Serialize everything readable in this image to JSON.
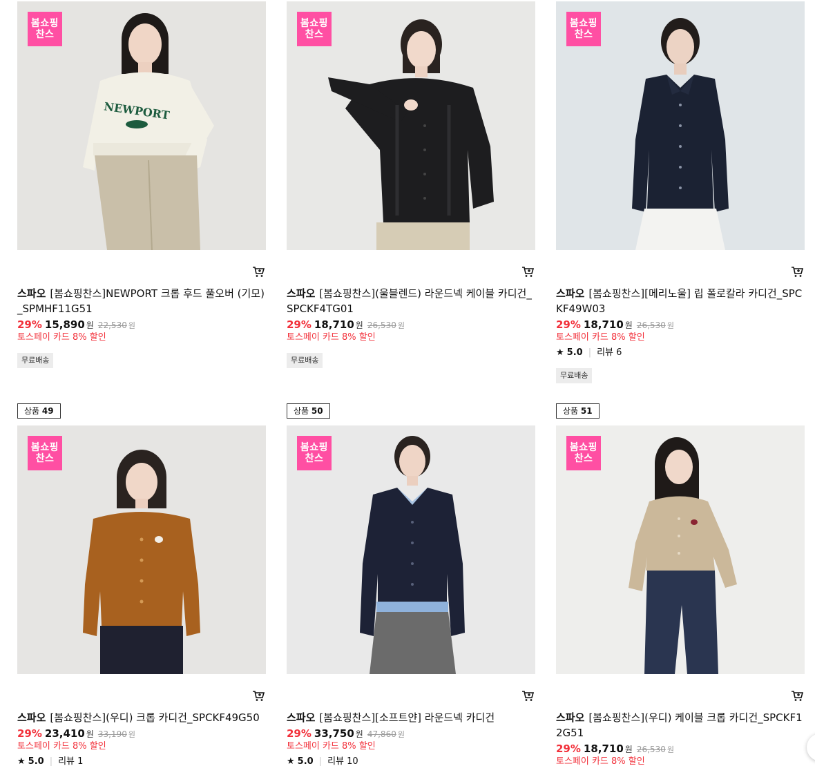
{
  "badge_label": "봄쇼핑찬스",
  "currency": "원",
  "free_shipping": "무료배송",
  "promo_label": "토스페이 카드 8% 할인",
  "review_label": "리뷰",
  "product_number_prefix": "상품",
  "products": [
    {
      "brand": "스파오",
      "name": "[봄쇼핑찬스]NEWPORT 크롭 후드 풀오버 (기모)_SPMHF11G51",
      "discount": "29%",
      "sale_price": "15,890",
      "original_price": "22,530",
      "free_shipping": true
    },
    {
      "brand": "스파오",
      "name": "[봄쇼핑찬스](울블렌드) 라운드넥 케이블 카디건_SPCKF4TG01",
      "discount": "29%",
      "sale_price": "18,710",
      "original_price": "26,530",
      "free_shipping": true
    },
    {
      "brand": "스파오",
      "name": "[봄쇼핑찬스][메리노울] 립 폴로칼라 카디건_SPCKF49W03",
      "discount": "29%",
      "sale_price": "18,710",
      "original_price": "26,530",
      "rating": "5.0",
      "review_count": "6",
      "free_shipping": true
    },
    {
      "product_number": "49",
      "brand": "스파오",
      "name": "[봄쇼핑찬스](우디) 크롭 카디건_SPCKF49G50",
      "discount": "29%",
      "sale_price": "23,410",
      "original_price": "33,190",
      "rating": "5.0",
      "review_count": "1"
    },
    {
      "product_number": "50",
      "brand": "스파오",
      "name": "[봄쇼핑찬스][소프트얀] 라운드넥 카디건",
      "discount": "29%",
      "sale_price": "33,750",
      "original_price": "47,860",
      "rating": "5.0",
      "review_count": "10"
    },
    {
      "product_number": "51",
      "brand": "스파오",
      "name": "[봄쇼핑찬스](우디) 케이블 크롭 카디건_SPCKF12G51",
      "discount": "29%",
      "sale_price": "18,710",
      "original_price": "26,530"
    }
  ],
  "colors": {
    "badge_pink": "#ff4fa3",
    "discount_red": "#f2303a",
    "promo_red": "#f2303a",
    "tag_gray": "#ececec"
  }
}
